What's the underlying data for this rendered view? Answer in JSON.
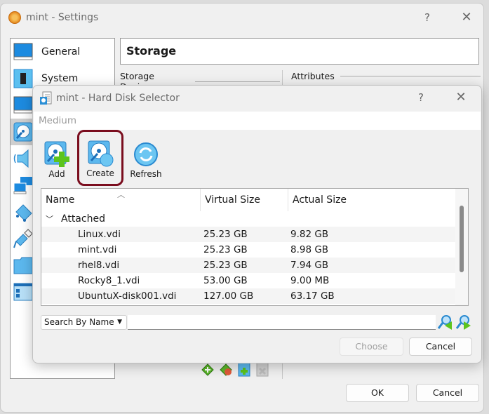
{
  "settings_window": {
    "title": "mint - Settings",
    "help_label": "?",
    "close_label": "✕",
    "sidebar": {
      "items": [
        {
          "label": "General",
          "icon": "monitor-icon"
        },
        {
          "label": "System",
          "icon": "chip-icon"
        },
        {
          "label": "",
          "icon": "display-icon"
        },
        {
          "label": "",
          "icon": "storage-icon",
          "selected": true
        },
        {
          "label": "",
          "icon": "audio-icon"
        },
        {
          "label": "",
          "icon": "network-icon"
        },
        {
          "label": "",
          "icon": "serial-port-icon"
        },
        {
          "label": "",
          "icon": "usb-icon"
        },
        {
          "label": "",
          "icon": "shared-folder-icon"
        },
        {
          "label": "",
          "icon": "user-interface-icon"
        }
      ]
    },
    "section_title": "Storage",
    "storage_devices_label": "Storage Devices",
    "attributes_label": "Attributes",
    "ok_label": "OK",
    "cancel_label": "Cancel"
  },
  "selector_dialog": {
    "title": "mint - Hard Disk Selector",
    "help_label": "?",
    "close_label": "✕",
    "medium_label": "Medium",
    "toolbar": {
      "add_label": "Add",
      "create_label": "Create",
      "refresh_label": "Refresh"
    },
    "table": {
      "columns": [
        "Name",
        "Virtual Size",
        "Actual Size"
      ],
      "groups": [
        {
          "label": "Attached",
          "expanded": true,
          "rows": [
            {
              "name": "Linux.vdi",
              "virtual": "25.23 GB",
              "actual": "9.82 GB"
            },
            {
              "name": "mint.vdi",
              "virtual": "25.23 GB",
              "actual": "8.98 GB"
            },
            {
              "name": "rhel8.vdi",
              "virtual": "25.23 GB",
              "actual": "7.94 GB"
            },
            {
              "name": "Rocky8_1.vdi",
              "virtual": "53.00 GB",
              "actual": "9.00 MB"
            },
            {
              "name": "UbuntuX-disk001.vdi",
              "virtual": "127.00 GB",
              "actual": "63.17 GB"
            }
          ]
        }
      ]
    },
    "search": {
      "mode": "Search By Name",
      "value": ""
    },
    "choose_label": "Choose",
    "cancel_label": "Cancel"
  },
  "colors": {
    "highlight_border": "#7a0d1e",
    "icon_blue": "#2b8fd6",
    "icon_green": "#5cc41d"
  }
}
